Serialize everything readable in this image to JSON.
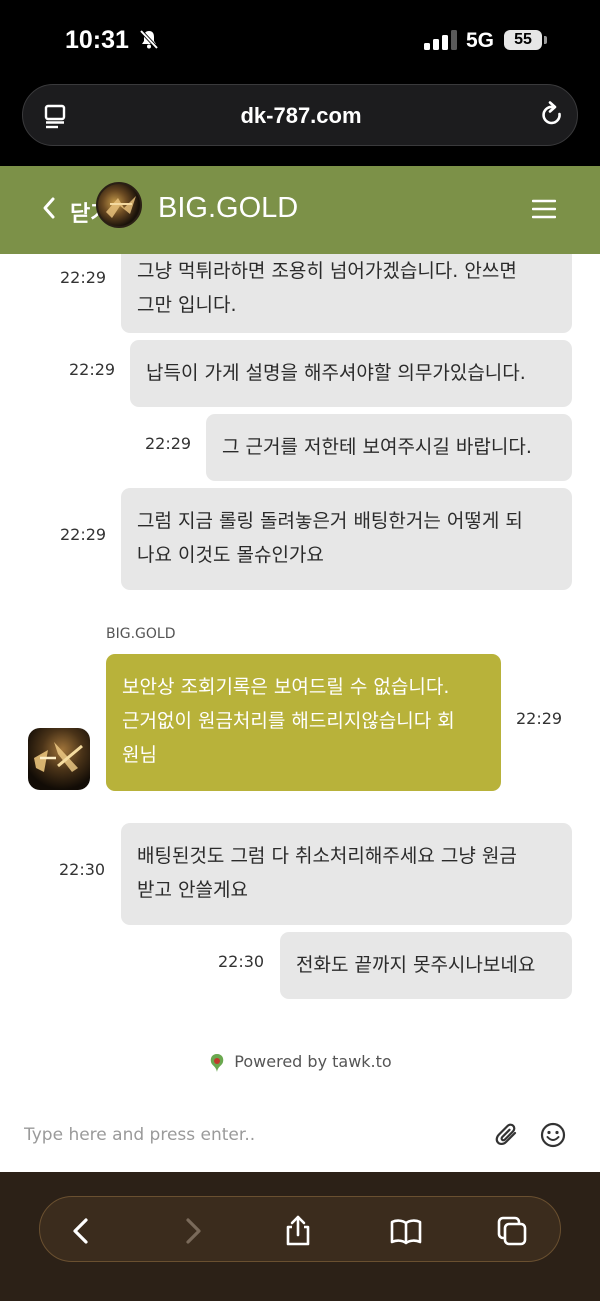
{
  "status_bar": {
    "time": "10:31",
    "network": "5G",
    "battery": "55"
  },
  "browser": {
    "url": "dk-787.com"
  },
  "chat_header": {
    "close_label": "닫기",
    "title": "BIG.GOLD"
  },
  "messages": [
    {
      "time": "22:29",
      "lines": [
        "그냥 먹튀라하면 조용히 넘어가겠습니다. 안쓰면",
        "그만 입니다."
      ]
    },
    {
      "time": "22:29",
      "lines": [
        "납득이 가게 설명을 해주셔야할 의무가있습니다."
      ]
    },
    {
      "time": "22:29",
      "lines": [
        "그 근거를 저한테 보여주시길 바랍니다."
      ]
    },
    {
      "time": "22:29",
      "lines": [
        "그럼 지금 롤링 돌려놓은거 배팅한거는 어떻게 되",
        "나요 이것도 몰슈인가요"
      ]
    }
  ],
  "agent_message": {
    "name": "BIG.GOLD",
    "time": "22:29",
    "lines": [
      "보안상 조회기록은 보여드릴 수 없습니다.",
      "근거없이 원금처리를 해드리지않습니다 회",
      "원님"
    ]
  },
  "messages_after": [
    {
      "time": "22:30",
      "lines": [
        "배팅된것도 그럼 다 취소처리해주세요 그냥 원금",
        "받고 안쓸게요"
      ]
    },
    {
      "time": "22:30",
      "lines": [
        "전화도 끝까지 못주시나보네요"
      ]
    }
  ],
  "powered_by": "Powered by tawk.to",
  "input": {
    "placeholder": "Type here and press enter.."
  },
  "colors": {
    "header": "#7c9148",
    "agent_bubble": "#b8b23a",
    "user_bubble": "#e7e7e7"
  },
  "icons": [
    "mute-icon",
    "signal-icon",
    "reader-icon",
    "reload-icon",
    "back-icon",
    "menu-icon",
    "tawk-icon",
    "attach-icon",
    "emoji-icon",
    "back-arrow-icon",
    "forward-arrow-icon",
    "share-icon",
    "bookmarks-icon",
    "tabs-icon"
  ]
}
